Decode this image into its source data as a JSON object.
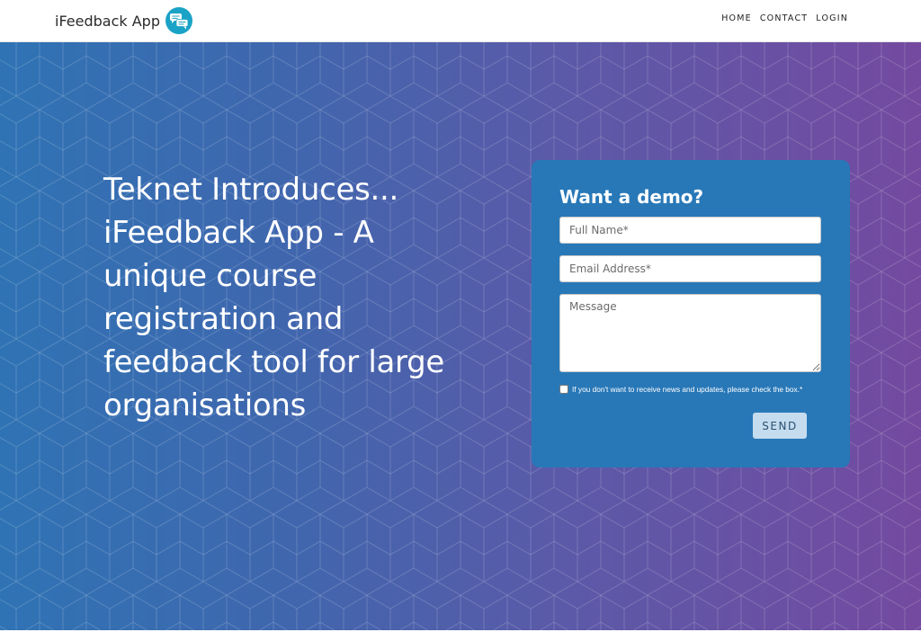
{
  "header": {
    "brand_name": "iFeedback App",
    "logo_icon": "chat-bubbles-icon",
    "nav": [
      "HOME",
      "CONTACT",
      "LOGIN"
    ]
  },
  "hero": {
    "headline": "Teknet Introduces... iFeedback App - A unique course registration and feedback tool for large organisations",
    "gradient_start": "#2f73b4",
    "gradient_end": "#744aa0"
  },
  "demo_form": {
    "title": "Want a demo?",
    "full_name": {
      "placeholder": "Full Name*",
      "value": ""
    },
    "email": {
      "placeholder": "Email Address*",
      "value": ""
    },
    "message": {
      "placeholder": "Message",
      "value": ""
    },
    "consent_label": "If you don't want to receive news and updates, please check the box.*",
    "consent_checked": false,
    "send_label": "SEND",
    "card_color": "#2878b8",
    "button_color": "#c5dcef"
  }
}
